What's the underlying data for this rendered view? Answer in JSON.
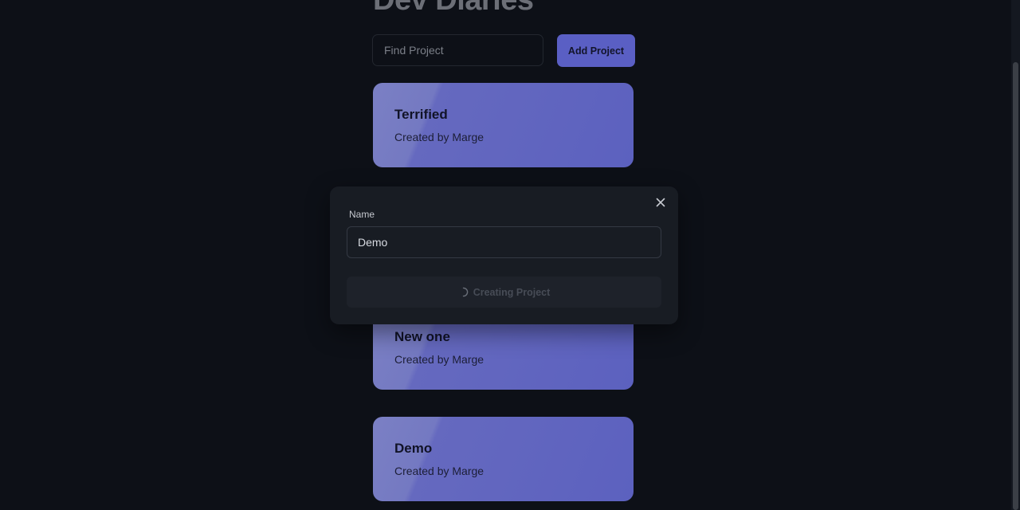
{
  "header": {
    "title": "Dev Diaries"
  },
  "search": {
    "placeholder": "Find Project"
  },
  "toolbar": {
    "add_label": "Add Project"
  },
  "projects": [
    {
      "name": "Terrified",
      "creator_text": "Created by Marge"
    },
    {
      "name": "New one",
      "creator_text": "Created by Marge"
    },
    {
      "name": "Demo",
      "creator_text": "Created by Marge"
    }
  ],
  "modal": {
    "field_label": "Name",
    "field_value": "Demo",
    "submit_label": "Creating Project",
    "close_icon": "close-icon",
    "spinner_icon": "spinner-icon"
  },
  "colors": {
    "background": "#0d1017",
    "accent": "#5a5fc4",
    "card_gradient_start": "#7b80c4",
    "card_gradient_end": "#5c61bf",
    "modal_bg": "#181c23"
  }
}
